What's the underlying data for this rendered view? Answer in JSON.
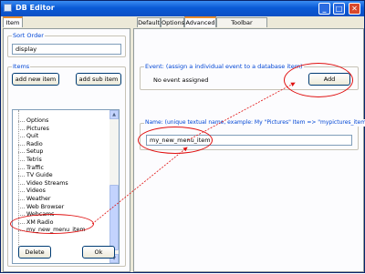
{
  "window": {
    "title": "DB Editor",
    "minimize": "_",
    "maximize": "□",
    "close": "✕"
  },
  "left_tabs": [
    "Item"
  ],
  "sort_order": {
    "label": "Sort Order",
    "value": "display"
  },
  "items": {
    "label": "Items",
    "add_new_item": "add new item",
    "add_sub_item": "add sub item",
    "list": [
      "Options",
      "Pictures",
      "Quit",
      "Radio",
      "Setup",
      "Tetris",
      "Traffic",
      "TV Guide",
      "Video Streams",
      "Videos",
      "Weather",
      "Web Browser",
      "Webcams",
      "XM Radio",
      "my_new_menu_item"
    ]
  },
  "bottom_buttons": {
    "delete": "Delete",
    "ok": "Ok"
  },
  "right_tabs": [
    "Default",
    "Options",
    "Advanced",
    "Toolbar Advanced"
  ],
  "event_group": {
    "label": "Event: (assign a individual event to a database item)",
    "status": "No event assigned",
    "add_button": "Add"
  },
  "name_group": {
    "label": "Name: (unique textual name, example: My \"Pictures\" Item => \"mypictures_item\")",
    "value": "my_new_menu_item"
  },
  "colors": {
    "annotation": "#e01010",
    "tab_highlight": "#e68b2c",
    "group_label": "#0046d5"
  }
}
